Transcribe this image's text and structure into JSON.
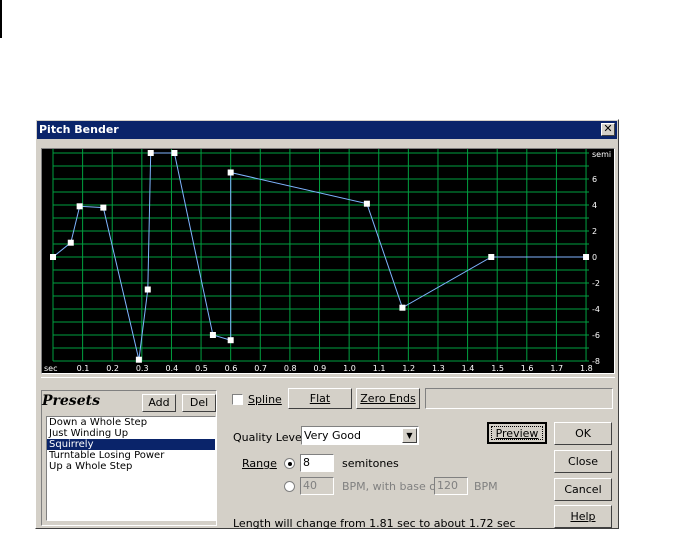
{
  "window": {
    "title": "Pitch Bender",
    "close_glyph": "✕"
  },
  "graph": {
    "x_ticks": [
      "sec",
      "0.1",
      "0.2",
      "0.3",
      "0.4",
      "0.5",
      "0.6",
      "0.7",
      "0.8",
      "0.9",
      "1.0",
      "1.1",
      "1.2",
      "1.3",
      "1.4",
      "1.5",
      "1.6",
      "1.7",
      "1.8"
    ],
    "y_unit": "semi",
    "y_ticks": [
      "6",
      "4",
      "2",
      "0",
      "-2",
      "-4",
      "-6",
      "-8"
    ],
    "colors": {
      "background": "#000000",
      "grid": "#00a040",
      "line": "#7fb4ff",
      "point": "#ffffff",
      "tick_text": "#ffffff"
    }
  },
  "chart_data": {
    "type": "line",
    "xlabel": "sec",
    "ylabel": "semi",
    "xlim": [
      0,
      1.81
    ],
    "ylim": [
      -8,
      8
    ],
    "points": [
      [
        0.0,
        0
      ],
      [
        0.06,
        1.1
      ],
      [
        0.09,
        3.9
      ],
      [
        0.17,
        3.8
      ],
      [
        0.29,
        -7.9
      ],
      [
        0.32,
        -2.5
      ],
      [
        0.33,
        8
      ],
      [
        0.41,
        8
      ],
      [
        0.54,
        -6
      ],
      [
        0.6,
        -6.4
      ],
      [
        0.6,
        6.5
      ],
      [
        1.06,
        4.1
      ],
      [
        1.18,
        -3.9
      ],
      [
        1.48,
        0
      ],
      [
        1.8,
        0
      ]
    ]
  },
  "toolbar": {
    "spline_label": "Spline",
    "spline_checked": false,
    "flat_label": "Flat",
    "zero_ends_label": "Zero Ends"
  },
  "presets": {
    "title": "Presets",
    "add_label": "Add",
    "del_label": "Del",
    "items": [
      "Down a Whole Step",
      "Just Winding Up",
      "Squirrely",
      "Turntable Losing Power",
      "Up a Whole Step"
    ],
    "selected": "Squirrely"
  },
  "settings": {
    "quality_label": "Quality Level",
    "quality_value": "Very Good",
    "range_label": "Range",
    "semitones_value": "8",
    "semitones_label": "semitones",
    "bpm_value": "40",
    "bpm_label": "BPM, with base of",
    "base_value": "120",
    "base_unit": "BPM",
    "status_text": "Length will change from 1.81 sec to about 1.72 sec"
  },
  "buttons": {
    "preview": "Preview",
    "ok": "OK",
    "close": "Close",
    "cancel": "Cancel",
    "help": "Help"
  }
}
